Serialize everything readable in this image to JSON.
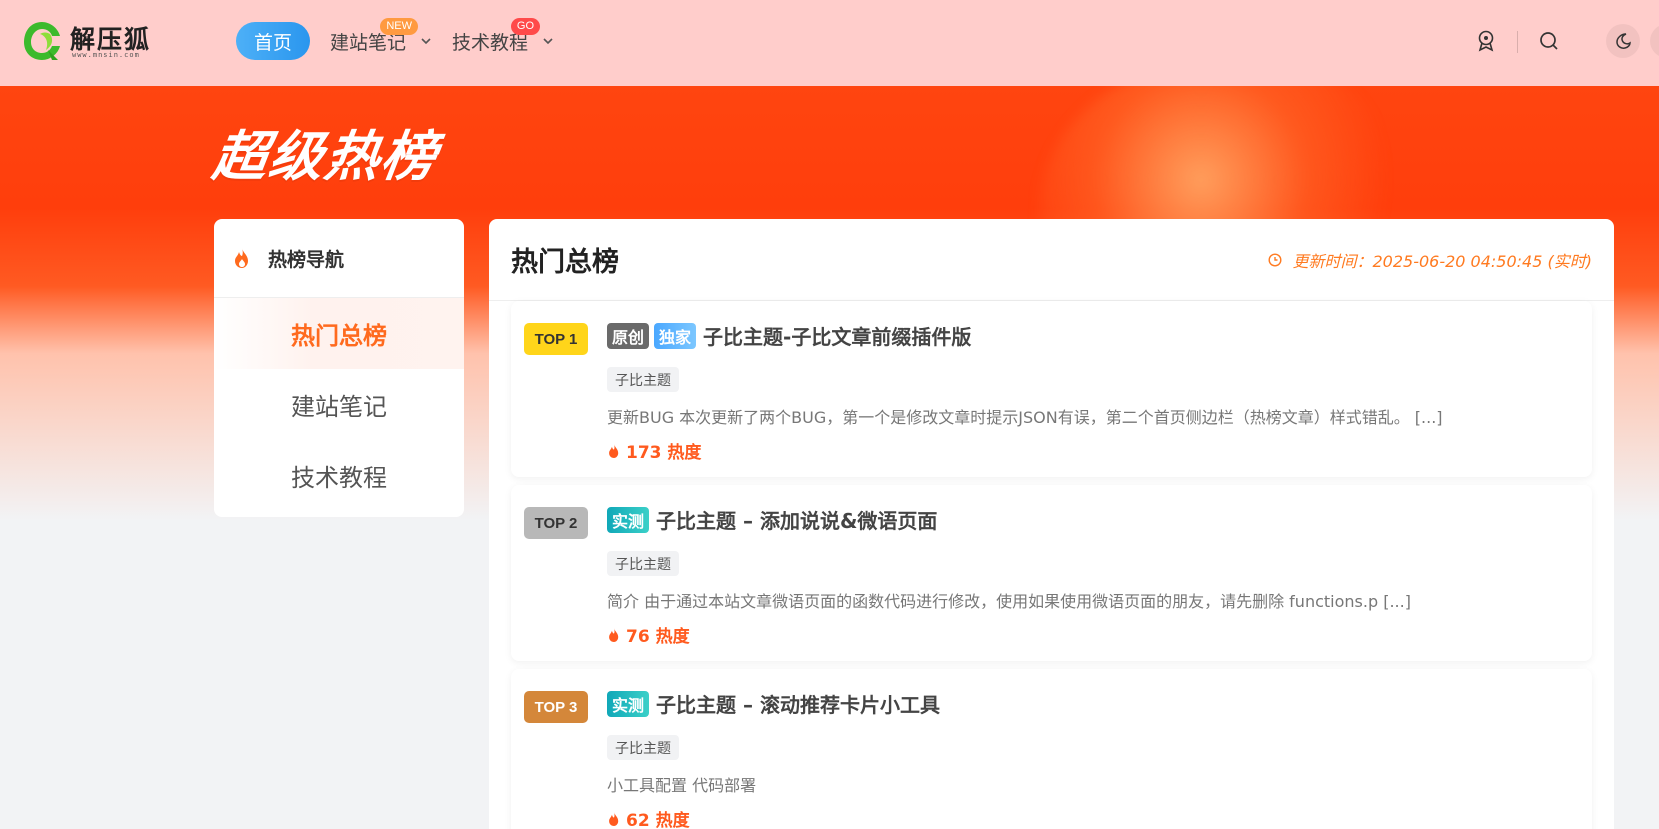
{
  "header": {
    "logo_title": "解压狐",
    "logo_sub": "www.mnsin.com",
    "nav": [
      {
        "label": "首页"
      },
      {
        "label": "建站笔记",
        "badge": "NEW"
      },
      {
        "label": "技术教程",
        "badge": "GO"
      }
    ],
    "icons": [
      "award-icon",
      "search-icon",
      "moon-icon"
    ]
  },
  "hero": {
    "title": "超级热榜"
  },
  "sidebar": {
    "heading": "热榜导航",
    "items": [
      {
        "label": "热门总榜",
        "active": true
      },
      {
        "label": "建站笔记",
        "active": false
      },
      {
        "label": "技术教程",
        "active": false
      }
    ]
  },
  "main": {
    "title": "热门总榜",
    "update_time": "更新时间：2025-06-20 04:50:45 (实时)",
    "posts": [
      {
        "rank": "TOP 1",
        "tags": [
          "原创",
          "独家"
        ],
        "title": "子比主题-子比文章前缀插件版",
        "category": "子比主题",
        "excerpt": "更新BUG 本次更新了两个BUG，第一个是修改文章时提示JSON有误，第二个首页侧边栏（热榜文章）样式错乱。 [...]",
        "heat": "173 热度"
      },
      {
        "rank": "TOP 2",
        "tags": [
          "实测"
        ],
        "title": "子比主题 – 添加说说&微语页面",
        "category": "子比主题",
        "excerpt": "简介 由于通过本站文章微语页面的函数代码进行修改，使用如果使用微语页面的朋友，请先删除 functions.p [...]",
        "heat": "76 热度"
      },
      {
        "rank": "TOP 3",
        "tags": [
          "实测"
        ],
        "title": "子比主题 – 滚动推荐卡片小工具",
        "category": "子比主题",
        "excerpt": "小工具配置 代码部署",
        "heat": "62 热度"
      }
    ]
  },
  "colors": {
    "accent": "#ff6a1e",
    "hero": "#ff4a12",
    "header_bg": "#ffcdcb",
    "nav_active": "#2a96ee"
  }
}
